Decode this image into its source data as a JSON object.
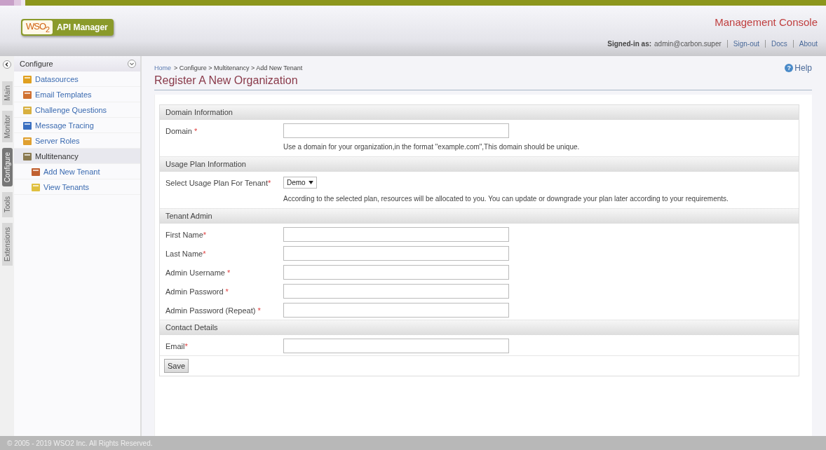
{
  "header": {
    "logo_mark": "WSO$_{2}$",
    "logo_product": "API Manager",
    "title": "Management Console",
    "signed_in_label": "Signed-in as:",
    "user": "admin@carbon.super",
    "links": [
      "Sign-out",
      "Docs",
      "About"
    ]
  },
  "side_tabs": [
    {
      "label": "Main",
      "selected": false
    },
    {
      "label": "Monitor",
      "selected": false
    },
    {
      "label": "Configure",
      "selected": true
    },
    {
      "label": "Tools",
      "selected": false
    },
    {
      "label": "Extensions",
      "selected": false
    }
  ],
  "sidebar": {
    "title": "Configure",
    "items": [
      {
        "label": "Datasources",
        "selected": false
      },
      {
        "label": "Email Templates",
        "selected": false
      },
      {
        "label": "Challenge Questions",
        "selected": false
      },
      {
        "label": "Message Tracing",
        "selected": false
      },
      {
        "label": "Server Roles",
        "selected": false
      },
      {
        "label": "Multitenancy",
        "selected": true,
        "children": [
          {
            "label": "Add New Tenant",
            "selected": false
          },
          {
            "label": "View Tenants",
            "selected": false
          }
        ]
      }
    ]
  },
  "breadcrumb": {
    "home": "Home",
    "rest": "> Configure > Multitenancy > Add New Tenant"
  },
  "help": {
    "icon": "?",
    "label": "Help"
  },
  "page_title": "Register A New Organization",
  "sections": [
    {
      "title": "Domain Information",
      "rows": [
        {
          "kind": "text",
          "label": "Domain",
          "mark": " *",
          "hint": "Use a domain for your organization,in the format \"example.com\",This domain should be unique."
        }
      ]
    },
    {
      "title": "Usage Plan Information",
      "rows": [
        {
          "kind": "select",
          "label": "Select Usage Plan For Tenant",
          "mark": "*",
          "value": "Demo",
          "hint": "According to the selected plan, resources will be allocated to you. You can update or downgrade your plan later according to your requirements."
        }
      ]
    },
    {
      "title": "Tenant Admin",
      "rows": [
        {
          "kind": "text",
          "label": "First Name",
          "mark": "*"
        },
        {
          "kind": "text",
          "label": "Last Name",
          "mark": "*"
        },
        {
          "kind": "text",
          "label": "Admin Username",
          "mark": " *"
        },
        {
          "kind": "text",
          "label": "Admin Password",
          "mark": " *"
        },
        {
          "kind": "text",
          "label": "Admin Password (Repeat)",
          "mark": " *"
        }
      ]
    },
    {
      "title": "Contact Details",
      "rows": [
        {
          "kind": "text",
          "label": "Email",
          "mark": "*"
        }
      ]
    }
  ],
  "save_button": "Save",
  "footer": "© 2005 - 2019 WSO2 Inc. All Rights Reserved."
}
